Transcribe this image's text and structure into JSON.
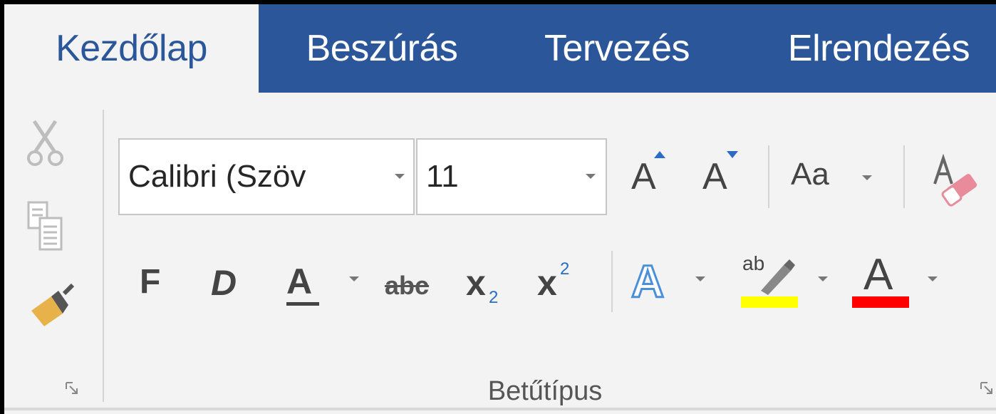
{
  "tabs": [
    {
      "label": "Kezdőlap",
      "active": true
    },
    {
      "label": "Beszúrás",
      "active": false
    },
    {
      "label": "Tervezés",
      "active": false
    },
    {
      "label": "Elrendezés",
      "active": false
    }
  ],
  "font": {
    "name_value": "Calibri (Szöv",
    "size_value": "11"
  },
  "buttons": {
    "bold": "F",
    "italic": "D",
    "underline": "A",
    "strikethrough": "abc",
    "subscript_base": "x",
    "subscript_sub": "2",
    "superscript_base": "x",
    "superscript_sup": "2",
    "grow_font": "A",
    "shrink_font": "A",
    "change_case": "Aa",
    "text_effects": "A",
    "highlight": "ab",
    "font_color": "A"
  },
  "group": {
    "label": "Betűtípus"
  },
  "colors": {
    "tab_bar": "#2b579a",
    "highlight": "#ffff00",
    "font_color": "#ff0000"
  }
}
